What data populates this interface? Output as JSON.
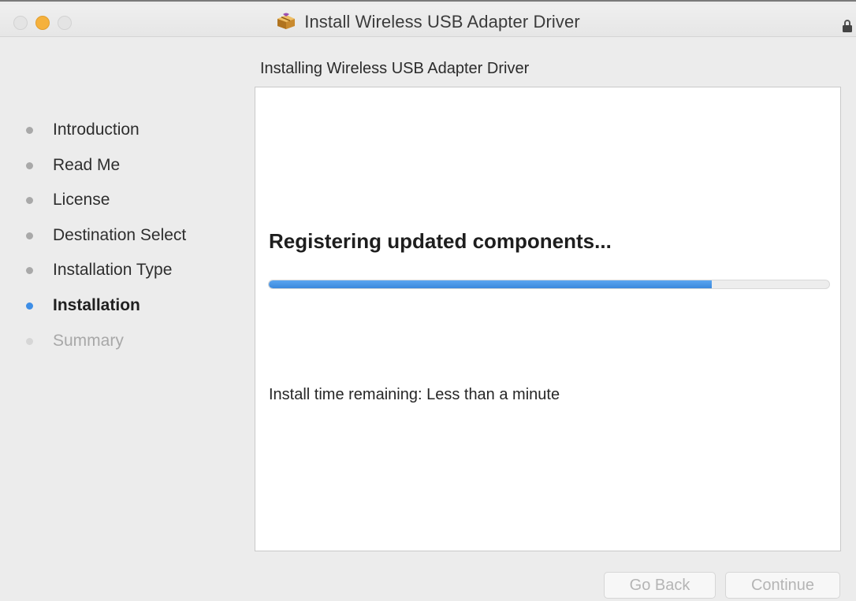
{
  "window": {
    "title": "Install Wireless USB Adapter Driver",
    "icons": [
      "package-icon",
      "lock-icon"
    ]
  },
  "header": {
    "subtitle": "Installing Wireless USB Adapter Driver"
  },
  "sidebar": {
    "items": [
      {
        "label": "Introduction",
        "state": "done"
      },
      {
        "label": "Read Me",
        "state": "done"
      },
      {
        "label": "License",
        "state": "done"
      },
      {
        "label": "Destination Select",
        "state": "done"
      },
      {
        "label": "Installation Type",
        "state": "done"
      },
      {
        "label": "Installation",
        "state": "active"
      },
      {
        "label": "Summary",
        "state": "pending"
      }
    ]
  },
  "main": {
    "status": "Registering updated components...",
    "progress_percent": 79,
    "time_remaining": "Install time remaining: Less than a minute"
  },
  "footer": {
    "back_label": "Go Back",
    "continue_label": "Continue"
  },
  "colors": {
    "accent": "#3e8ee6",
    "minimize": "#f5b13c"
  }
}
